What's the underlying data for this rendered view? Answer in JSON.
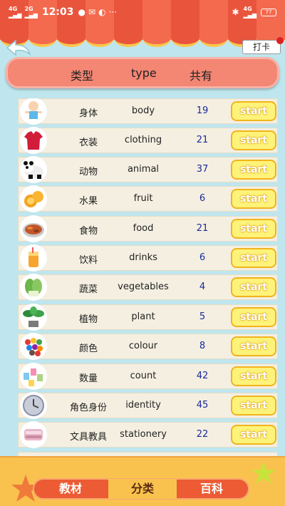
{
  "status_bar": {
    "signal_left": "4G",
    "signal_left2": "2G",
    "time": "12:03",
    "icons_more": "···",
    "signal_right": "4G",
    "battery": "77"
  },
  "toolbar": {
    "checkin_label": "打卡"
  },
  "header": {
    "col_type_cn": "类型",
    "col_type_en": "type",
    "col_total": "共有"
  },
  "categories": [
    {
      "cn": "身体",
      "en": "body",
      "count": "19",
      "start": "start",
      "icon": "body-icon"
    },
    {
      "cn": "衣装",
      "en": "clothing",
      "count": "21",
      "start": "start",
      "icon": "clothing-icon"
    },
    {
      "cn": "动物",
      "en": "animal",
      "count": "37",
      "start": "start",
      "icon": "panda-icon"
    },
    {
      "cn": "水果",
      "en": "fruit",
      "count": "6",
      "start": "start",
      "icon": "orange-icon"
    },
    {
      "cn": "食物",
      "en": "food",
      "count": "21",
      "start": "start",
      "icon": "food-icon"
    },
    {
      "cn": "饮料",
      "en": "drinks",
      "count": "6",
      "start": "start",
      "icon": "juice-icon"
    },
    {
      "cn": "蔬菜",
      "en": "vegetables",
      "count": "4",
      "start": "start",
      "icon": "cabbage-icon"
    },
    {
      "cn": "植物",
      "en": "plant",
      "count": "5",
      "start": "start",
      "icon": "plant-icon"
    },
    {
      "cn": "颜色",
      "en": "colour",
      "count": "8",
      "start": "start",
      "icon": "candy-icon"
    },
    {
      "cn": "数量",
      "en": "count",
      "count": "42",
      "start": "start",
      "icon": "numbers-icon"
    },
    {
      "cn": "角色身份",
      "en": "identity",
      "count": "45",
      "start": "start",
      "icon": "clock-icon"
    },
    {
      "cn": "文具教具",
      "en": "stationery",
      "count": "22",
      "start": "start",
      "icon": "pencil-case-icon"
    }
  ],
  "bottom_nav": {
    "tab_textbook": "教材",
    "tab_category": "分类",
    "tab_encyclopedia": "百科",
    "active": "分类"
  },
  "colors": {
    "awning_red": "#e9543c",
    "header_pink": "#f48674",
    "count_blue": "#1a2a9c",
    "start_yellow": "#fef37a",
    "nav_orange": "#ec5b33"
  }
}
